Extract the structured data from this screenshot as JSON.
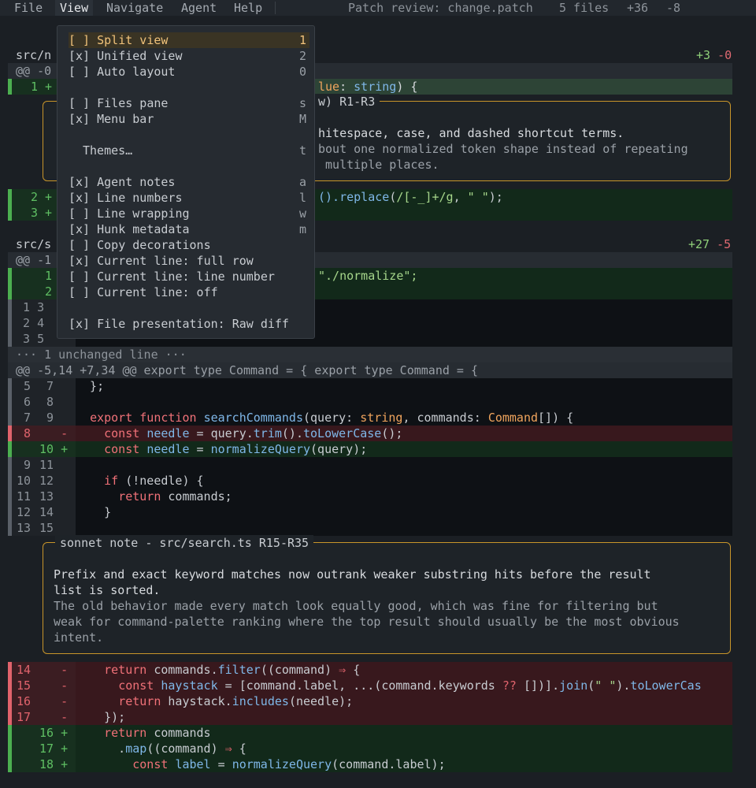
{
  "menubar": {
    "items": [
      "File",
      "View",
      "Navigate",
      "Agent",
      "Help"
    ],
    "title": "Patch review: change.patch",
    "files": "5 files",
    "added": "+36",
    "removed": "-8"
  },
  "view_menu": [
    {
      "label": "[ ] Split view",
      "key": "1"
    },
    {
      "label": "[x] Unified view",
      "key": "2"
    },
    {
      "label": "[ ] Auto layout",
      "key": "0"
    },
    {
      "label": "[ ] Files pane",
      "key": "s"
    },
    {
      "label": "[x] Menu bar",
      "key": "M"
    },
    {
      "label": "Themes…",
      "key": "t"
    },
    {
      "label": "[x] Agent notes",
      "key": "a"
    },
    {
      "label": "[x] Line numbers",
      "key": "l"
    },
    {
      "label": "[ ] Line wrapping",
      "key": "w"
    },
    {
      "label": "[x] Hunk metadata",
      "key": "m"
    },
    {
      "label": "[ ] Copy decorations",
      "key": ""
    },
    {
      "label": "[x] Current line: full row",
      "key": ""
    },
    {
      "label": "[ ] Current line: line number",
      "key": ""
    },
    {
      "label": "[ ] Current line: off",
      "key": ""
    },
    {
      "label": "[x] File presentation: Raw diff",
      "key": ""
    }
  ],
  "file1": {
    "name": "src/n",
    "added": "+3",
    "removed": "-0",
    "hunk": "@@ -0",
    "line1_num": "1 +",
    "line1_code": "lue: string) {",
    "note_title": "w) R1-R3",
    "note_lines": [
      "hitespace, case, and dashed shortcut terms.",
      "bout one normalized token shape instead of repeating",
      " multiple places."
    ],
    "line2_num": "2 +",
    "line2_code": "().replace(/[-_]+/g, \" \");",
    "line3_num": "3 +"
  },
  "file2": {
    "name": "src/s",
    "added": "+27",
    "removed": "-5",
    "hunk": "@@ -1",
    "import_new_1": "1",
    "import_new_2": "2",
    "import_code": "\"./normalize\";",
    "ctx_lines": [
      {
        "old": "1",
        "new": "3"
      },
      {
        "old": "2",
        "new": "4"
      },
      {
        "old": "3",
        "new": "5"
      }
    ],
    "collapsed": "··· 1 unchanged line ···",
    "hunk2": "@@ -5,14 +7,34 @@ export type Command = { export type Command = {",
    "rows": [
      {
        "old": " 5",
        "new": " 7",
        "code": "  };"
      },
      {
        "old": " 6",
        "new": " 8",
        "code": ""
      },
      {
        "old": " 7",
        "new": " 9",
        "code": "  export function searchCommands(query: string, commands: Command[]) {"
      },
      {
        "old": " 8",
        "new": "",
        "sign": "-",
        "code": "    const needle = query.trim().toLowerCase();"
      },
      {
        "old": "",
        "new": "10",
        "sign": "+",
        "code": "    const needle = normalizeQuery(query);"
      },
      {
        "old": " 9",
        "new": "11",
        "code": ""
      },
      {
        "old": "10",
        "new": "12",
        "code": "    if (!needle) {"
      },
      {
        "old": "11",
        "new": "13",
        "code": "      return commands;"
      },
      {
        "old": "12",
        "new": "14",
        "code": "    }"
      },
      {
        "old": "13",
        "new": "15",
        "code": ""
      }
    ],
    "note_title": "sonnet note - src/search.ts R15-R35",
    "note_summary": [
      "Prefix and exact keyword matches now outrank weaker substring hits before the result",
      "list is sorted."
    ],
    "note_detail": [
      "The old behavior made every match look equally good, which was fine for filtering but",
      "weak for command-palette ranking where the top result should usually be the most obvious",
      "intent."
    ],
    "rows2": [
      {
        "old": "14",
        "new": "",
        "sign": "-",
        "code": "    return commands.filter((command) ⇒ {"
      },
      {
        "old": "15",
        "new": "",
        "sign": "-",
        "code": "      const haystack = [command.label, ...(command.keywords ?? [])].join(\" \").toLowerCas"
      },
      {
        "old": "16",
        "new": "",
        "sign": "-",
        "code": "      return haystack.includes(needle);"
      },
      {
        "old": "17",
        "new": "",
        "sign": "-",
        "code": "    });"
      },
      {
        "old": "",
        "new": "16",
        "sign": "+",
        "code": "    return commands"
      },
      {
        "old": "",
        "new": "17",
        "sign": "+",
        "code": "      .map((command) ⇒ {"
      },
      {
        "old": "",
        "new": "18",
        "sign": "+",
        "code": "        const label = normalizeQuery(command.label);"
      }
    ]
  }
}
